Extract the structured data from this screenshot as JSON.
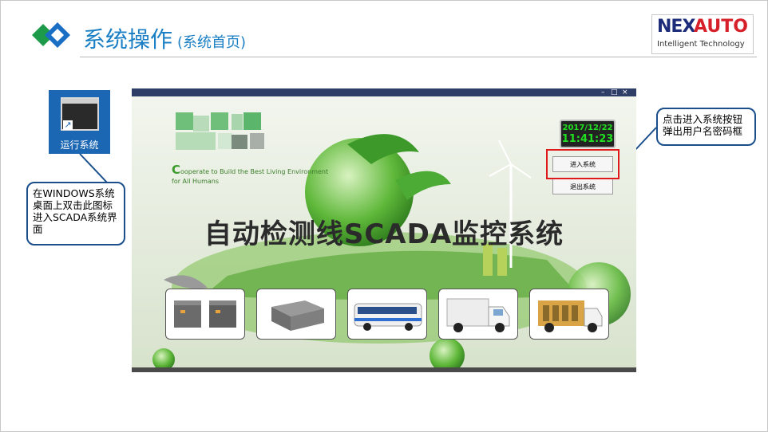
{
  "slide": {
    "title": "系统操作",
    "subtitle": "(系统首页)",
    "brand": {
      "ne": "NEX",
      "auto": "AUTO",
      "tagline": "Intelligent Technology",
      "colors": {
        "ne": "#1d2c7a",
        "auto": "#d6202a"
      }
    },
    "accent_color": "#1a7fc4"
  },
  "desktop_icon": {
    "label": "运行系统",
    "icon": "scada-app-icon"
  },
  "callouts": {
    "left": "在WINDOWS系统桌面上双击此图标进入SCADA系统界面",
    "right": "点击进入系统按钮弹出用户名密码框"
  },
  "app": {
    "tagline_lead": "C",
    "tagline_line1": "ooperate  to Build the Best Living Environment",
    "tagline_line2": "for All Humans",
    "clock": {
      "date": "2017/12/22",
      "time": "11:41:23"
    },
    "enter_button": "进入系统",
    "exit_button": "退出系统",
    "main_title": "自动检测线SCADA监控系统",
    "thumbnails": [
      {
        "name": "battery-packs-thumbnail"
      },
      {
        "name": "battery-box-thumbnail"
      },
      {
        "name": "electric-bus-thumbnail"
      },
      {
        "name": "electric-truck-thumbnail"
      },
      {
        "name": "utility-vehicle-thumbnail"
      }
    ]
  }
}
